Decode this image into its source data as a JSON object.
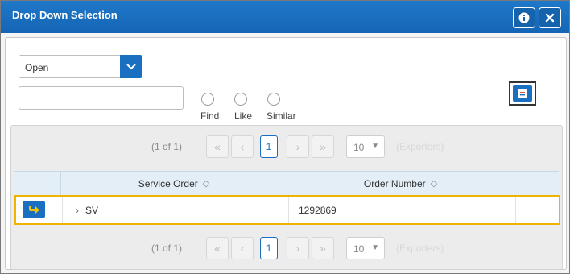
{
  "dialog": {
    "title": "Drop Down Selection",
    "info_icon": "info-icon",
    "close_icon": "close-icon",
    "accent": "#1a6fc0"
  },
  "filter": {
    "status_value": "Open",
    "search_value": "",
    "radios": [
      {
        "label": "Find"
      },
      {
        "label": "Like"
      },
      {
        "label": "Similar"
      }
    ]
  },
  "pager_top": {
    "info": "(1 of 1)",
    "current_page": "1",
    "page_size": "10",
    "export_label": "(Exporters)"
  },
  "pager_bottom": {
    "info": "(1 of 1)",
    "current_page": "1",
    "page_size": "10",
    "export_label": "(Exporters)"
  },
  "table": {
    "columns": [
      "Service Order",
      "Order Number"
    ],
    "rows": [
      {
        "service_order": "SV",
        "order_number": "1292869"
      }
    ],
    "selected_row_color": "#f0b400"
  }
}
